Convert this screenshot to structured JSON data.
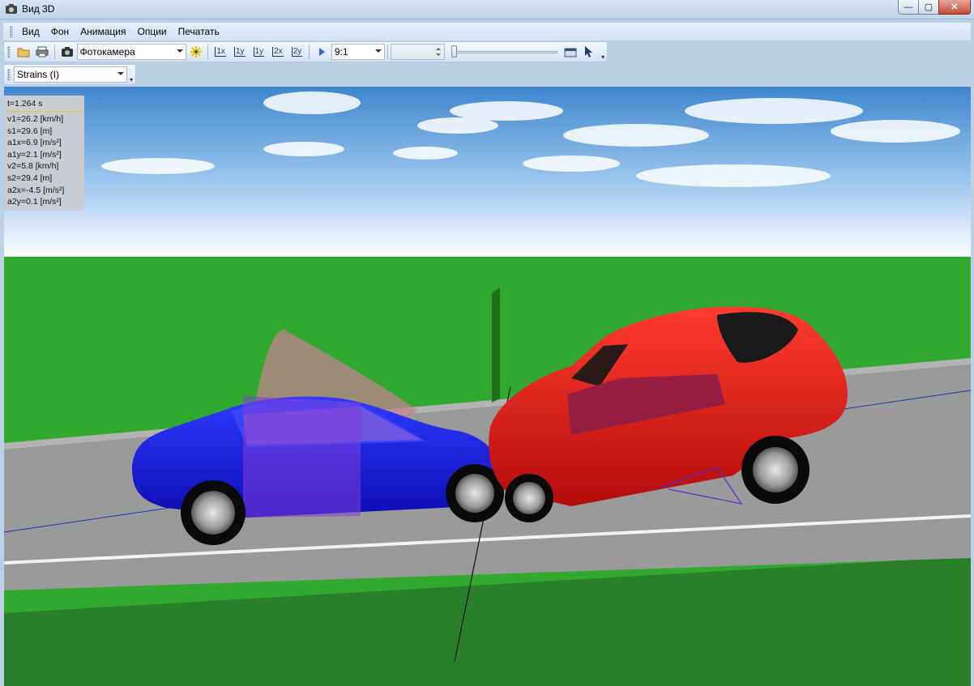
{
  "window": {
    "title": "Вид 3D"
  },
  "menu": [
    "Вид",
    "Фон",
    "Анимация",
    "Опции",
    "Печатать"
  ],
  "toolbar": {
    "camera": "Фотокамера",
    "axis_buttons": [
      "1x",
      "1y",
      "1y",
      "2x",
      "2y"
    ],
    "scale": "9:1",
    "speed_value": ""
  },
  "toolbar2": {
    "mode": "Strains (I)"
  },
  "info": {
    "time": "t=1.264 s",
    "rows": [
      "v1=26.2 [km/h]",
      "s1=29.6 [m]",
      "a1x=6.9 [m/s²]",
      "a1y=2.1 [m/s²]",
      "v2=5.8 [km/h]",
      "s2=29.4 [m]",
      "a2x=-4.5 [m/s²]",
      "a2y=0.1 [m/s²]"
    ]
  },
  "colors": {
    "sky_top": "#3f86cf",
    "grass": "#31a92f",
    "grass_dark": "#2a7f2a",
    "road": "#9a9a9a",
    "car1": "#1a1ae0",
    "car2": "#e01010"
  }
}
